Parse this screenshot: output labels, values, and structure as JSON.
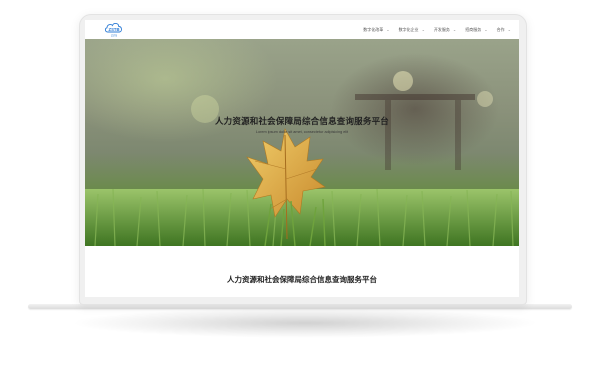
{
  "logo": {
    "icon": "cloud-logo-icon",
    "text": "ZSTB",
    "subtext": "ZSTB"
  },
  "nav": {
    "items": [
      {
        "label": "数字化改革",
        "icon": "chevron-down-icon"
      },
      {
        "label": "数字化企业",
        "icon": "chevron-down-icon"
      },
      {
        "label": "开发服务",
        "icon": "chevron-down-icon"
      },
      {
        "label": "招商服务",
        "icon": "chevron-down-icon"
      },
      {
        "label": "合作",
        "icon": "chevron-down-icon"
      }
    ]
  },
  "hero": {
    "title": "人力资源和社会保障局综合信息查询服务平台",
    "subtitle": "Lorem ipsum dolor sit amet, consectetur adipisicing elit"
  },
  "section": {
    "title": "人力资源和社会保障局综合信息查询服务平台"
  },
  "colors": {
    "accent": "#2b7bd6",
    "grass": "#5d8a34",
    "leaf": "#d9a443"
  }
}
